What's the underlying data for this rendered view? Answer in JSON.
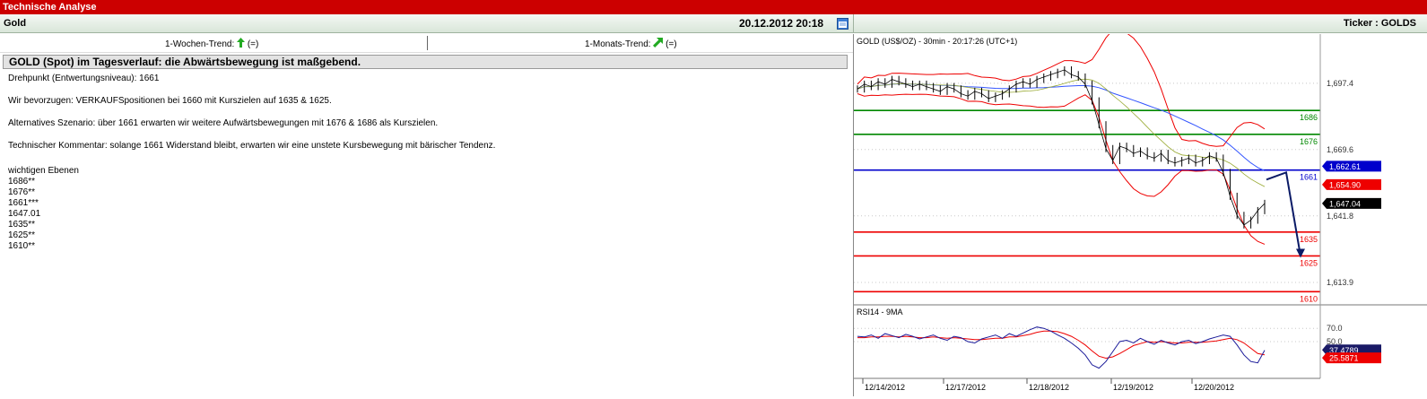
{
  "window_title": "Technische Analyse",
  "header": {
    "instrument": "Gold",
    "datetime": "20.12.2012 20:18",
    "ticker_label": "Ticker : GOLDS"
  },
  "trends": {
    "week_label": "1-Wochen-Trend:",
    "week_suffix": "(=)",
    "week_direction": "up",
    "month_label": "1-Monats-Trend:",
    "month_suffix": "(=)",
    "month_direction": "up-right"
  },
  "analysis": {
    "headline": "GOLD (Spot) im Tagesverlauf: die Abwärtsbewegung ist maßgebend.",
    "pivot": "Drehpunkt (Entwertungsniveau): 1661",
    "preferred": "Wir bevorzugen: VERKAUFSpositionen bei 1660 mit Kurszielen auf 1635 & 1625.",
    "alternative": "Alternatives Szenario: über 1661 erwarten wir weitere Aufwärtsbewegungen mit 1676 & 1686 als Kurszielen.",
    "comment": "Technischer Kommentar: solange 1661 Widerstand bleibt, erwarten wir eine unstete Kursbewegung mit bärischer Tendenz.",
    "levels_title": "wichtigen Ebenen",
    "levels": [
      "1686**",
      "1676**",
      "1661***",
      "1647.01",
      "1635**",
      "1625**",
      "1610**"
    ]
  },
  "chart_data": [
    {
      "type": "line",
      "title": "GOLD (US$/OZ) - 30min - 20:17:26 (UTC+1)",
      "x": [
        "12/14/2012",
        "12/17/2012",
        "12/18/2012",
        "12/19/2012",
        "12/20/2012"
      ],
      "y_ticks": [
        "1,697.4",
        "1,669.6",
        "1,641.8",
        "1,613.9"
      ],
      "ylim": [
        1606,
        1712
      ],
      "price_path": [
        1695,
        1697,
        1696,
        1698,
        1697,
        1699,
        1698,
        1697,
        1696,
        1697,
        1696,
        1695,
        1694,
        1696,
        1695,
        1693,
        1692,
        1694,
        1693,
        1691,
        1692,
        1693,
        1695,
        1697,
        1698,
        1697,
        1699,
        1700,
        1701,
        1702,
        1703,
        1701,
        1700,
        1697,
        1690,
        1680,
        1670,
        1665,
        1671,
        1670,
        1668,
        1669,
        1667,
        1666,
        1668,
        1665,
        1664,
        1665,
        1666,
        1664,
        1665,
        1667,
        1666,
        1660,
        1650,
        1642,
        1638,
        1640,
        1644,
        1647
      ],
      "current_price": "1,647.04",
      "price_labels": [
        {
          "label": "1,662.61",
          "color": "#0000cc"
        },
        {
          "label": "1,654.90",
          "color": "#ee0000"
        }
      ],
      "levels": [
        {
          "value": 1686,
          "label": "1686",
          "color": "#008800"
        },
        {
          "value": 1676,
          "label": "1676",
          "color": "#008800"
        },
        {
          "value": 1661,
          "label": "1661",
          "color": "#0000cc"
        },
        {
          "value": 1635,
          "label": "1635",
          "color": "#ee0000"
        },
        {
          "value": 1625,
          "label": "1625",
          "color": "#ee0000"
        },
        {
          "value": 1610,
          "label": "1610",
          "color": "#ee0000"
        }
      ],
      "projection": [
        1657,
        1660,
        1625
      ]
    },
    {
      "type": "line",
      "title": "RSI14 - 9MA",
      "y_ticks": [
        "70.0",
        "50.0"
      ],
      "ylim": [
        0,
        100
      ],
      "rsi": [
        58,
        57,
        60,
        55,
        62,
        59,
        56,
        61,
        58,
        54,
        57,
        60,
        55,
        52,
        58,
        56,
        50,
        48,
        54,
        57,
        60,
        55,
        62,
        58,
        63,
        68,
        72,
        70,
        66,
        60,
        55,
        48,
        40,
        30,
        15,
        10,
        20,
        35,
        50,
        52,
        48,
        55,
        50,
        46,
        52,
        48,
        45,
        50,
        52,
        47,
        50,
        54,
        57,
        60,
        58,
        45,
        30,
        20,
        18,
        37
      ],
      "rsi_ma": [
        56,
        56,
        57,
        57,
        58,
        58,
        57,
        58,
        57,
        56,
        56,
        57,
        56,
        55,
        56,
        55,
        54,
        53,
        53,
        54,
        55,
        55,
        57,
        57,
        59,
        61,
        64,
        66,
        66,
        65,
        62,
        58,
        52,
        45,
        36,
        28,
        25,
        27,
        32,
        38,
        44,
        47,
        50,
        49,
        50,
        49,
        48,
        48,
        49,
        49,
        49,
        50,
        51,
        53,
        55,
        53,
        48,
        40,
        32,
        30
      ],
      "current_rsi": "37.4789",
      "current_ma": "25.5871"
    }
  ],
  "colors": {
    "title_bar": "#cc0000",
    "support": "#ee0000",
    "resistance": "#008800",
    "pivot": "#0000cc",
    "trend_arrow": "#22aa22"
  }
}
